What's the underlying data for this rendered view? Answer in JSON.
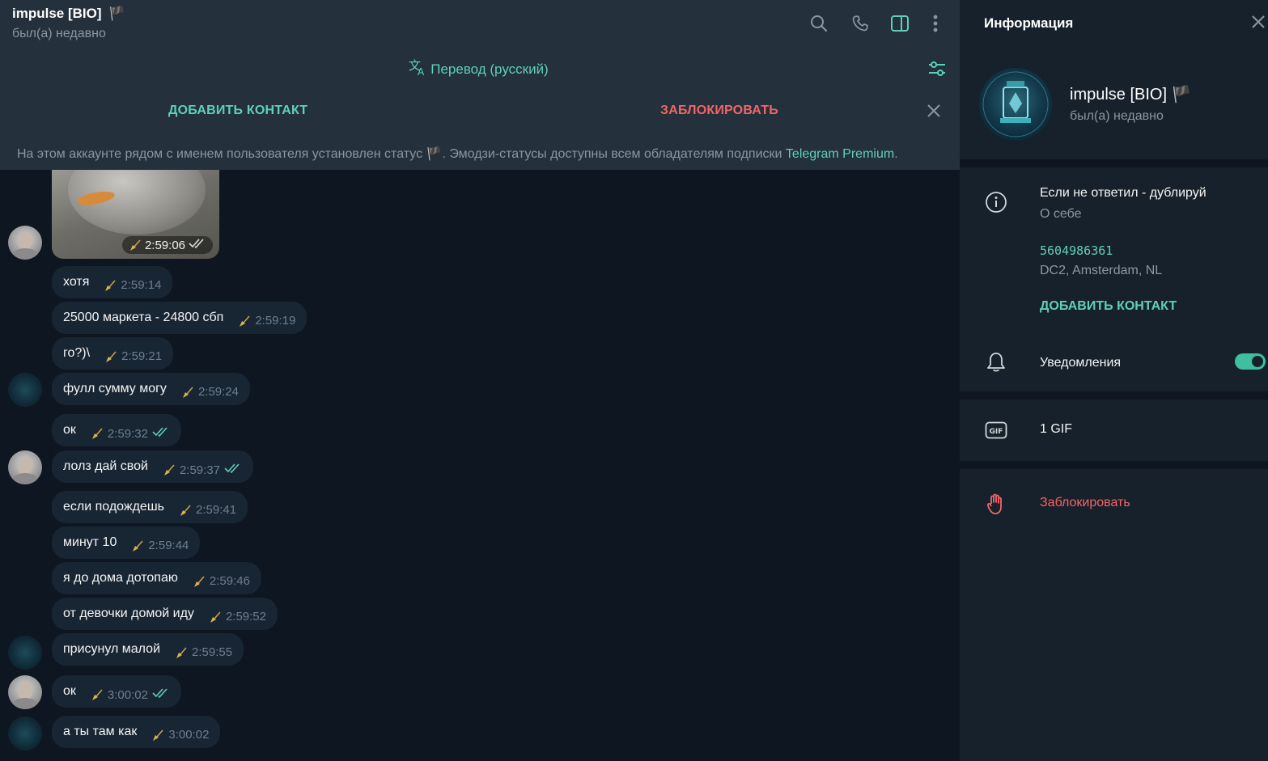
{
  "header": {
    "title": "impulse [BIO]",
    "title_flag": "🏴",
    "status": "был(а) недавно",
    "icons": [
      "search-icon",
      "phone-icon",
      "sidebar-toggle-icon",
      "more-vertical-icon"
    ]
  },
  "translate_bar": {
    "label": "Перевод (русский)",
    "icon": "translate-icon",
    "settings_icon": "filter-settings-icon"
  },
  "contact_banner": {
    "add_label": "ДОБАВИТЬ КОНТАКТ",
    "block_label": "ЗАБЛОКИРОВАТЬ"
  },
  "notice": {
    "text_before": "На этом аккаунте рядом с именем пользователя установлен статус",
    "flag": "🏴",
    "text_after": ". Эмодзи-статусы доступны всем обладателям подписки",
    "link": "Telegram Premium",
    "text_end": "."
  },
  "messages": {
    "media": {
      "time": "2:59:06",
      "read": true
    },
    "items": [
      {
        "text": "хотя",
        "time": "2:59:14",
        "read": false
      },
      {
        "text": "25000 маркета - 24800 сбп",
        "time": "2:59:19",
        "read": false
      },
      {
        "text": "го?)\\",
        "time": "2:59:21",
        "read": false
      },
      {
        "text": "фулл сумму могу",
        "time": "2:59:24",
        "read": false
      },
      {
        "text": "ок",
        "time": "2:59:32",
        "read": true
      },
      {
        "text": "лолз дай свой",
        "time": "2:59:37",
        "read": true
      },
      {
        "text": "если подождешь",
        "time": "2:59:41",
        "read": false
      },
      {
        "text": "минут 10",
        "time": "2:59:44",
        "read": false
      },
      {
        "text": "я до дома дотопаю",
        "time": "2:59:46",
        "read": false
      },
      {
        "text": "от девочки домой иду",
        "time": "2:59:52",
        "read": false
      },
      {
        "text": "присунул малой",
        "time": "2:59:55",
        "read": false
      },
      {
        "text": "ок",
        "time": "3:00:02",
        "read": true
      },
      {
        "text": "а ты там как",
        "time": "3:00:02",
        "read": false
      }
    ]
  },
  "info_panel": {
    "title": "Информация",
    "name": "impulse [BIO]",
    "name_flag": "🏴",
    "status": "был(а) недавно",
    "bio": "Если не ответил - дублируй",
    "bio_label": "О себе",
    "user_id": "5604986361",
    "dc": "DC2, Amsterdam, NL",
    "add_contact": "ДОБАВИТЬ КОНТАКТ",
    "notifications_label": "Уведомления",
    "notifications_on": true,
    "gif_label": "1 GIF",
    "block_label": "Заблокировать"
  },
  "colors": {
    "accent": "#5fd0b8",
    "danger": "#f26567",
    "bubble": "#182533",
    "chat_bg": "#0e1621",
    "panel_bg": "#17212b"
  }
}
